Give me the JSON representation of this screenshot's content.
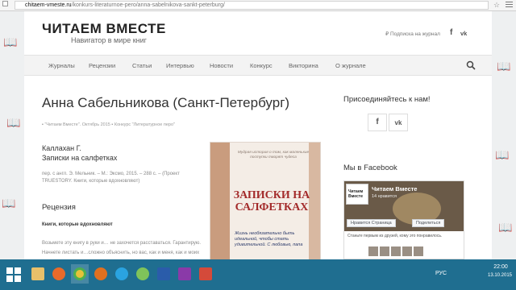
{
  "browser": {
    "url_host": "chitaem-vmeste.ru",
    "url_path": "/konkurs-literaturnoe-pero/anna-sabelnikova-sankt-peterburg/"
  },
  "header": {
    "title": "ЧИТАЕМ ВМЕСТЕ",
    "tagline": "Навигатор в мире книг",
    "subscribe": "Подписка на журнал",
    "fb_icon": "f",
    "vk_icon": "vk"
  },
  "nav": {
    "items": [
      "Журналы",
      "Рецензии",
      "Статьи",
      "Интервью",
      "Новости",
      "Конкурс",
      "Викторина",
      "О журнале"
    ]
  },
  "article": {
    "title": "Анна Сабельникова (Санкт-Петербург)",
    "meta_author": "\"Читаем Вместе\". Октябрь 2015",
    "meta_category": "Конкурс \"Литературное перо\"",
    "book_author": "Каллахан Г.",
    "book_title": "Записки на салфетках",
    "pub_info": "пер. с англ. Э. Мельник. – М.: Эксмо, 2015. – 288 с. – (Проект TRUESTORY. Книги, которые вдохновляют)",
    "review_heading": "Рецензия",
    "bold_line": "Книги, которые вдохновляют",
    "body_text": "Возьмете эту книгу в руки и… не захочется расставаться. Гарантирую. Начнете листать и…сложно объяснить, но вас, как и меня, как и моих друзей (проверено!), охватит такое чувство…"
  },
  "book_cover": {
    "tagline": "Мудрая история о том, как маленькие поступки творят чудеса",
    "title": "ЗАПИСКИ НА САЛФЕТКАХ",
    "handnote": "Жизнь необязательно быть идеальной, чтобы стать удивительной. С любовью, папа"
  },
  "sidebar": {
    "join_heading": "Присоединяйтесь к нам!",
    "fb_icon": "f",
    "vk_icon": "vk",
    "fb_heading": "Мы в Facebook",
    "widget": {
      "thumb_text": "Читаем Вместе",
      "page_name": "Читаем Вместе",
      "likes": "14 нравится",
      "like_button": "Нравится Страница",
      "share_button": "Поделиться",
      "friends_text": "Станьте первым из друзей, кому это понравилось."
    }
  },
  "taskbar": {
    "lang": "РУС",
    "time": "22:00",
    "date": "13.10.2015"
  }
}
